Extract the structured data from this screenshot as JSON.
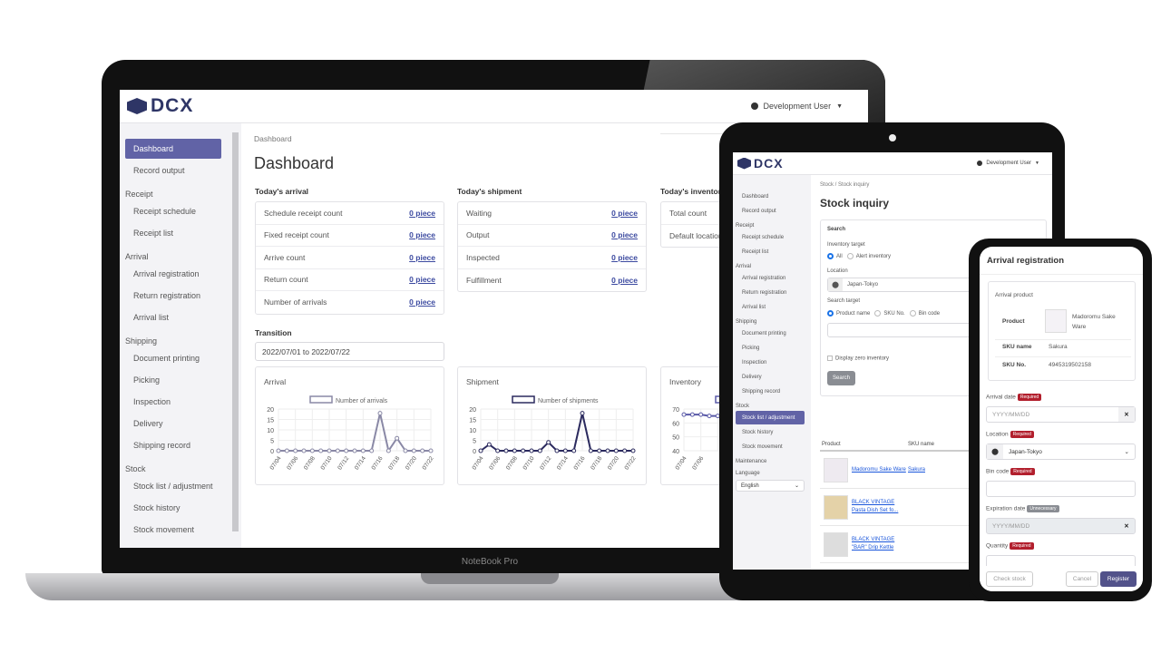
{
  "laptop": {
    "brand": "NoteBook Pro",
    "logo": "DCX",
    "user": "Development User",
    "sidebar": [
      {
        "type": "item",
        "label": "Dashboard",
        "active": true
      },
      {
        "type": "item",
        "label": "Record output"
      },
      {
        "type": "group",
        "label": "Receipt"
      },
      {
        "type": "item",
        "label": "Receipt schedule"
      },
      {
        "type": "item",
        "label": "Receipt list"
      },
      {
        "type": "group",
        "label": "Arrival"
      },
      {
        "type": "item",
        "label": "Arrival registration"
      },
      {
        "type": "item",
        "label": "Return registration"
      },
      {
        "type": "item",
        "label": "Arrival list"
      },
      {
        "type": "group",
        "label": "Shipping"
      },
      {
        "type": "item",
        "label": "Document printing"
      },
      {
        "type": "item",
        "label": "Picking"
      },
      {
        "type": "item",
        "label": "Inspection"
      },
      {
        "type": "item",
        "label": "Delivery"
      },
      {
        "type": "item",
        "label": "Shipping record"
      },
      {
        "type": "group",
        "label": "Stock"
      },
      {
        "type": "item",
        "label": "Stock list / adjustment"
      },
      {
        "type": "item",
        "label": "Stock history"
      },
      {
        "type": "item",
        "label": "Stock movement"
      }
    ],
    "breadcrumb": "Dashboard",
    "title": "Dashboard",
    "arrival": {
      "title": "Today's arrival",
      "rows": [
        {
          "label": "Schedule receipt count",
          "value": "0 piece"
        },
        {
          "label": "Fixed receipt count",
          "value": "0 piece"
        },
        {
          "label": "Arrive count",
          "value": "0 piece"
        },
        {
          "label": "Return count",
          "value": "0 piece"
        },
        {
          "label": "Number of arrivals",
          "value": "0 piece"
        }
      ]
    },
    "shipment": {
      "title": "Today's shipment",
      "rows": [
        {
          "label": "Waiting",
          "value": "0 piece"
        },
        {
          "label": "Output",
          "value": "0 piece"
        },
        {
          "label": "Inspected",
          "value": "0 piece"
        },
        {
          "label": "Fulfillment",
          "value": "0 piece"
        }
      ]
    },
    "inventory": {
      "title": "Today's inventory",
      "rows": [
        {
          "label": "Total count",
          "value": ""
        },
        {
          "label": "Default location",
          "value": ""
        }
      ]
    },
    "transition": {
      "label": "Transition",
      "range": "2022/07/01 to 2022/07/22"
    }
  },
  "chart_data": [
    {
      "type": "line",
      "title": "Arrival",
      "series": [
        {
          "name": "Number of arrivals",
          "color": "#8a89a6",
          "values": [
            0,
            0,
            0,
            0,
            0,
            0,
            0,
            0,
            0,
            0,
            0,
            0,
            18,
            0,
            6,
            0,
            0,
            0,
            0
          ]
        }
      ],
      "x": [
        "07/04",
        "07/05",
        "07/06",
        "07/07",
        "07/08",
        "07/09",
        "07/10",
        "07/11",
        "07/12",
        "07/13",
        "07/14",
        "07/15",
        "07/16",
        "07/17",
        "07/18",
        "07/19",
        "07/20",
        "07/21",
        "07/22"
      ],
      "xticks": [
        "07/04",
        "07/06",
        "07/08",
        "07/10",
        "07/12",
        "07/14",
        "07/16",
        "07/18",
        "07/20",
        "07/22"
      ],
      "yticks": [
        0,
        5,
        10,
        15,
        20
      ],
      "ylim": [
        0,
        20
      ],
      "grid": true,
      "legend": "top"
    },
    {
      "type": "line",
      "title": "Shipment",
      "series": [
        {
          "name": "Number of shipments",
          "color": "#2b2a5e",
          "values": [
            0,
            3,
            0,
            0,
            0,
            0,
            0,
            0,
            4,
            0,
            0,
            0,
            18,
            0,
            0,
            0,
            0,
            0,
            0
          ]
        }
      ],
      "x": [
        "07/04",
        "07/05",
        "07/06",
        "07/07",
        "07/08",
        "07/09",
        "07/10",
        "07/11",
        "07/12",
        "07/13",
        "07/14",
        "07/15",
        "07/16",
        "07/17",
        "07/18",
        "07/19",
        "07/20",
        "07/21",
        "07/22"
      ],
      "xticks": [
        "07/04",
        "07/06",
        "07/08",
        "07/10",
        "07/12",
        "07/14",
        "07/16",
        "07/18",
        "07/20",
        "07/22"
      ],
      "yticks": [
        0,
        5,
        10,
        15,
        20
      ],
      "ylim": [
        0,
        20
      ],
      "grid": true,
      "legend": "top"
    },
    {
      "type": "line",
      "title": "Inventory",
      "series": [
        {
          "color": "#5a5aa8",
          "values": [
            66,
            66,
            66,
            65,
            65
          ]
        }
      ],
      "x": [
        "07/04",
        "07/05",
        "07/06",
        "07/07",
        "07/08"
      ],
      "xticks": [
        "07/04",
        "07/06"
      ],
      "yticks": [
        40,
        50,
        60,
        70
      ],
      "ylim": [
        40,
        70
      ],
      "grid": true,
      "legend": "top"
    }
  ],
  "tablet": {
    "logo": "DCX",
    "user": "Development User",
    "sidebar": [
      {
        "type": "item",
        "label": "Dashboard"
      },
      {
        "type": "item",
        "label": "Record output"
      },
      {
        "type": "group",
        "label": "Receipt"
      },
      {
        "type": "item",
        "label": "Receipt schedule"
      },
      {
        "type": "item",
        "label": "Receipt list"
      },
      {
        "type": "group",
        "label": "Arrival"
      },
      {
        "type": "item",
        "label": "Arrival registration"
      },
      {
        "type": "item",
        "label": "Return registration"
      },
      {
        "type": "item",
        "label": "Arrival list"
      },
      {
        "type": "group",
        "label": "Shipping"
      },
      {
        "type": "item",
        "label": "Document printing"
      },
      {
        "type": "item",
        "label": "Picking"
      },
      {
        "type": "item",
        "label": "Inspection"
      },
      {
        "type": "item",
        "label": "Delivery"
      },
      {
        "type": "item",
        "label": "Shipping record"
      },
      {
        "type": "group",
        "label": "Stock"
      },
      {
        "type": "item",
        "label": "Stock list / adjustment",
        "active": true
      },
      {
        "type": "item",
        "label": "Stock history"
      },
      {
        "type": "item",
        "label": "Stock movement"
      },
      {
        "type": "group",
        "label": "Maintenance",
        "chevron": true
      },
      {
        "type": "group",
        "label": "Language"
      }
    ],
    "language": "English",
    "breadcrumb": [
      "Stock",
      "Stock inquiry"
    ],
    "title": "Stock inquiry",
    "search": {
      "title": "Search",
      "inventory_target": "Inventory target",
      "opt_all": "All",
      "opt_alert": "Alert inventory",
      "location_label": "Location",
      "location": "Japan-Tokyo",
      "search_target": "Search target",
      "opt_product": "Product name",
      "opt_sku": "SKU No.",
      "opt_bin": "Bin code",
      "zero": "Display zero inventory",
      "button": "Search"
    },
    "table": {
      "headers": [
        "Product",
        "SKU name"
      ],
      "rows": [
        {
          "product": "Madoromu Sake Ware",
          "sku": "Sakura"
        },
        {
          "product": "BLACK VINTAGE Pasta Dish Set fo...",
          "sku": ""
        },
        {
          "product": "BLACK VINTAGE \"BAR\" Drip Kettle",
          "sku": ""
        }
      ]
    }
  },
  "phone": {
    "title": "Arrival registration",
    "product_section": "Arrival product",
    "product_label": "Product",
    "product": "Madoromu Sake Ware",
    "sku_name_label": "SKU name",
    "sku_name": "Sakura",
    "sku_no_label": "SKU No.",
    "sku_no": "4945319502158",
    "arrival_date": "Arrival date",
    "date_placeholder": "YYYY/MM/DD",
    "location": "Location",
    "location_value": "Japan-Tokyo",
    "bin_code": "Bin code",
    "expiration": "Expiration date",
    "quantity": "Quantity",
    "required": "Required",
    "unnecessary": "Unnecessary",
    "check_stock": "Check stock",
    "cancel": "Cancel",
    "register": "Register"
  },
  "colors": {
    "accent": "#6163a6",
    "brand": "#2e3566",
    "required": "#b21f2d"
  }
}
